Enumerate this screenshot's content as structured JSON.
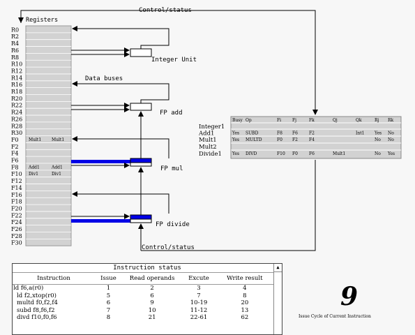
{
  "labels": {
    "control_status_top": "Control/status",
    "control_status_bottom": "Control/status",
    "registers": "Registers",
    "data_buses": "Data buses",
    "integer_unit": "Integer Unit",
    "fp_add": "FP add",
    "fp_mul": "FP mul",
    "fp_divide": "FP divide"
  },
  "registers": [
    "R0",
    "R2",
    "R4",
    "R6",
    "R8",
    "R10",
    "R12",
    "R14",
    "R16",
    "R18",
    "R20",
    "R22",
    "R24",
    "R26",
    "R28",
    "R30",
    "F0",
    "F2",
    "F4",
    "F6",
    "F8",
    "F10",
    "F12",
    "F14",
    "F16",
    "F18",
    "F20",
    "F22",
    "F24",
    "F26",
    "F28",
    "F30"
  ],
  "register_status": {
    "F0": [
      "Mult1",
      "Mult1"
    ],
    "F8": [
      "Add1",
      "Add1"
    ],
    "F10": [
      "Div1",
      "Div1"
    ]
  },
  "fu_status": {
    "headers": [
      "Busy",
      "Op",
      "Fi",
      "Fj",
      "Fk",
      "Qj",
      "Qk",
      "Rj",
      "Rk"
    ],
    "units": [
      {
        "name": "Integer1",
        "busy": "",
        "op": "",
        "fi": "",
        "fj": "",
        "fk": "",
        "qj": "",
        "qk": "",
        "rj": "",
        "rk": ""
      },
      {
        "name": "Add1",
        "busy": "Yes",
        "op": "SUBD",
        "fi": "F8",
        "fj": "F6",
        "fk": "F2",
        "qj": "",
        "qk": "Int1",
        "rj": "Yes",
        "rk": "No"
      },
      {
        "name": "Mult1",
        "busy": "Yes",
        "op": "MULTD",
        "fi": "F0",
        "fj": "F2",
        "fk": "F4",
        "qj": "",
        "qk": "",
        "rj": "No",
        "rk": "No"
      },
      {
        "name": "Mult2",
        "busy": "",
        "op": "",
        "fi": "",
        "fj": "",
        "fk": "",
        "qj": "",
        "qk": "",
        "rj": "",
        "rk": ""
      },
      {
        "name": "Divide1",
        "busy": "Yes",
        "op": "DIVD",
        "fi": "F10",
        "fj": "F0",
        "fk": "F6",
        "qj": "Mult1",
        "qk": "",
        "rj": "No",
        "rk": "Yes"
      }
    ]
  },
  "instruction_status": {
    "title": "Instruction status",
    "headers": [
      "Instruction",
      "Issue",
      "Read operands",
      "Excute",
      "Write result"
    ],
    "rows": [
      [
        "ld f6,a(r0)",
        "1",
        "2",
        "3",
        "4"
      ],
      [
        "ld f2,xtop(r0)",
        "5",
        "6",
        "7",
        "8"
      ],
      [
        "multd f0,f2,f4",
        "6",
        "9",
        "10-19",
        "20"
      ],
      [
        "subd f8,f6,f2",
        "7",
        "10",
        "11-12",
        "13"
      ],
      [
        "divd f10,f0,f6",
        "8",
        "21",
        "22-61",
        "62"
      ]
    ]
  },
  "cycle": {
    "value": "9",
    "label": "Issue Cycle of Current Instruction"
  },
  "colors": {
    "bus_active": "#0000e6",
    "register_bg": "#d2d2d2",
    "grid_line": "#ffffff"
  },
  "icons": {
    "scroll_up": "▲"
  }
}
